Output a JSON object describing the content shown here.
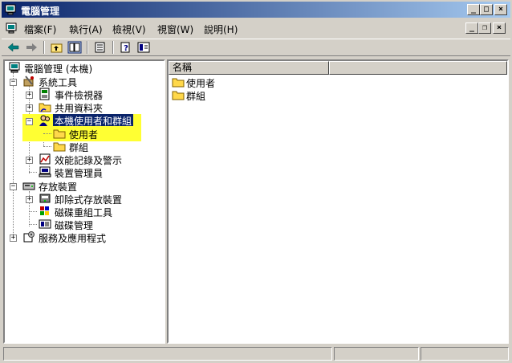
{
  "window": {
    "title": "電腦管理"
  },
  "menu": {
    "items": [
      "檔案(F)",
      "執行(A)",
      "檢視(V)",
      "視窗(W)",
      "說明(H)"
    ]
  },
  "tree": {
    "root": "電腦管理 (本機)",
    "system_tools": "系統工具",
    "event_viewer": "事件檢視器",
    "shared_folders": "共用資料夾",
    "local_users": "本機使用者和群組",
    "users": "使用者",
    "groups": "群組",
    "perf_logs": "效能記錄及警示",
    "device_manager": "裝置管理員",
    "storage": "存放裝置",
    "removable": "卸除式存放裝置",
    "defrag": "磁碟重組工具",
    "disk_mgmt": "磁碟管理",
    "services_apps": "服務及應用程式"
  },
  "list": {
    "header_name": "名稱",
    "items": [
      "使用者",
      "群組"
    ]
  },
  "colors": {
    "highlight": "#ffff33",
    "selection": "#0a246a"
  }
}
